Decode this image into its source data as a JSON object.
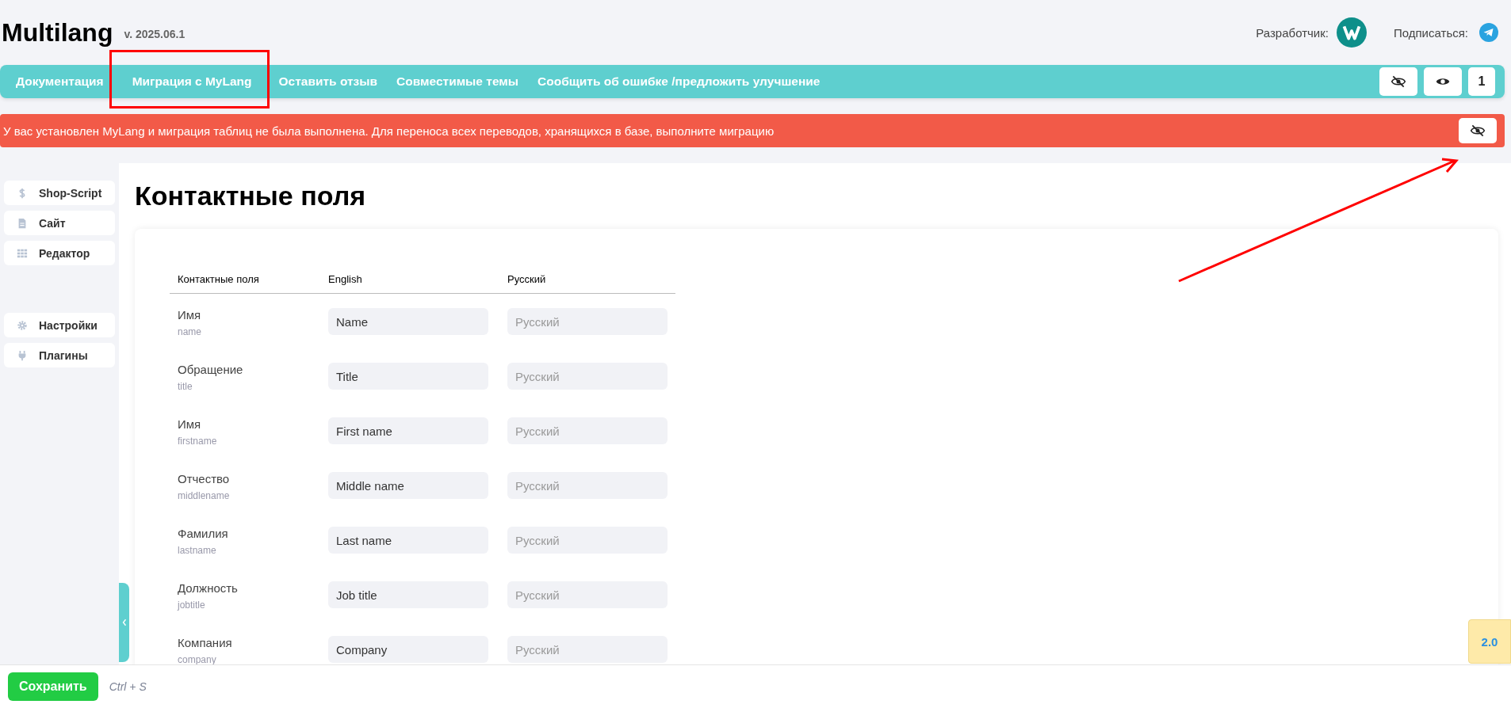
{
  "header": {
    "title": "Multilang",
    "version": "v. 2025.06.1",
    "developer_label": "Разработчик:",
    "subscribe_label": "Подписаться:"
  },
  "nav": {
    "items": [
      {
        "label": "Документация"
      },
      {
        "label": "Миграция с MyLang"
      },
      {
        "label": "Оставить отзыв"
      },
      {
        "label": "Совместимые темы"
      },
      {
        "label": "Сообщить об ошибке /предложить улучшение"
      }
    ],
    "buttons": [
      {
        "kind": "hide"
      },
      {
        "kind": "show"
      },
      {
        "kind": "count",
        "label": "1"
      }
    ]
  },
  "alert": {
    "text": "У вас установлен MyLang и миграция таблиц не была выполнена. Для переноса всех переводов, хранящихся в базе, выполните миграцию"
  },
  "sidebar": {
    "groups": [
      [
        {
          "label": "Shop-Script"
        },
        {
          "label": "Сайт"
        },
        {
          "label": "Редактор"
        }
      ],
      [
        {
          "label": "Настройки"
        },
        {
          "label": "Плагины"
        }
      ]
    ]
  },
  "page_title": "Контактные поля",
  "table": {
    "columns": [
      "Контактные поля",
      "English",
      "Русский"
    ],
    "rows": [
      {
        "label": "Имя",
        "key": "name",
        "english": "Name",
        "russian_placeholder": "Русский"
      },
      {
        "label": "Обращение",
        "key": "title",
        "english": "Title",
        "russian_placeholder": "Русский"
      },
      {
        "label": "Имя",
        "key": "firstname",
        "english": "First name",
        "russian_placeholder": "Русский"
      },
      {
        "label": "Отчество",
        "key": "middlename",
        "english": "Middle name",
        "russian_placeholder": "Русский"
      },
      {
        "label": "Фамилия",
        "key": "lastname",
        "english": "Last name",
        "russian_placeholder": "Русский"
      },
      {
        "label": "Должность",
        "key": "jobtitle",
        "english": "Job title",
        "russian_placeholder": "Русский"
      },
      {
        "label": "Компания",
        "key": "company",
        "english": "Company",
        "russian_placeholder": "Русский"
      }
    ]
  },
  "footer": {
    "save_label": "Сохранить",
    "shortcut": "Ctrl + S"
  },
  "version_badge": "2.0"
}
